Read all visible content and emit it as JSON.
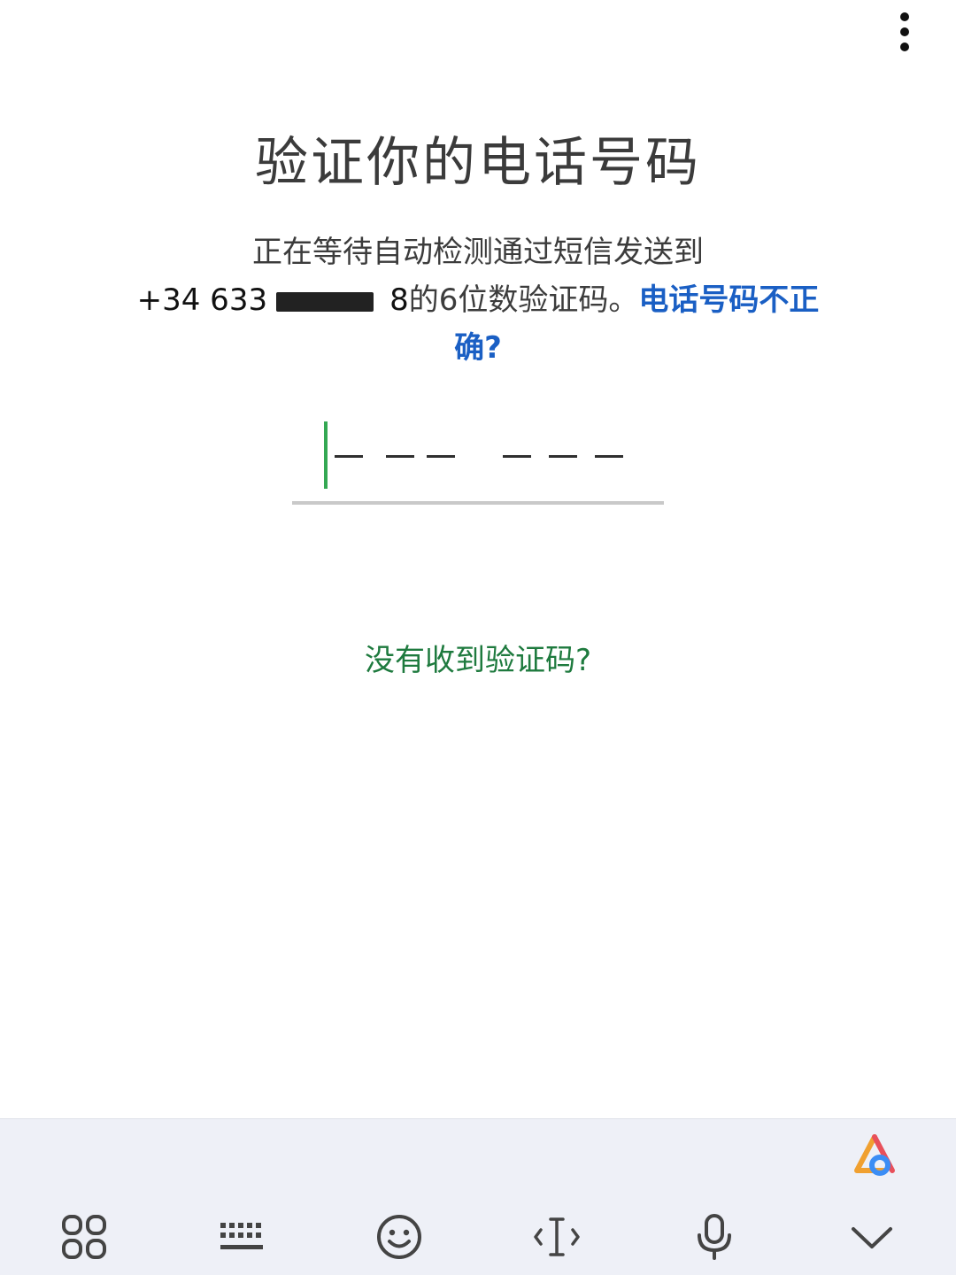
{
  "header": {
    "menu_icon": "more-vert-icon"
  },
  "title": "验证你的电话号码",
  "description": {
    "line1": "正在等待自动检测通过短信发送到",
    "phone_prefix": "+34 633",
    "phone_suffix": "8",
    "line2_rest": "的6位数验证码。",
    "wrong_number_link": "电话号码不正确?"
  },
  "code_input": {
    "digit_count": 6,
    "cursor_color": "#34a853"
  },
  "resend_link": "没有收到验证码?",
  "keyboard_bar": {
    "icons": [
      "apps-grid-icon",
      "keyboard-icon",
      "emoji-icon",
      "text-cursor-icon",
      "microphone-icon",
      "chevron-down-icon",
      "ai-assistant-icon"
    ]
  },
  "colors": {
    "link_blue": "#1a5fc4",
    "link_green": "#1e7a3e",
    "accent_green": "#34a853"
  }
}
